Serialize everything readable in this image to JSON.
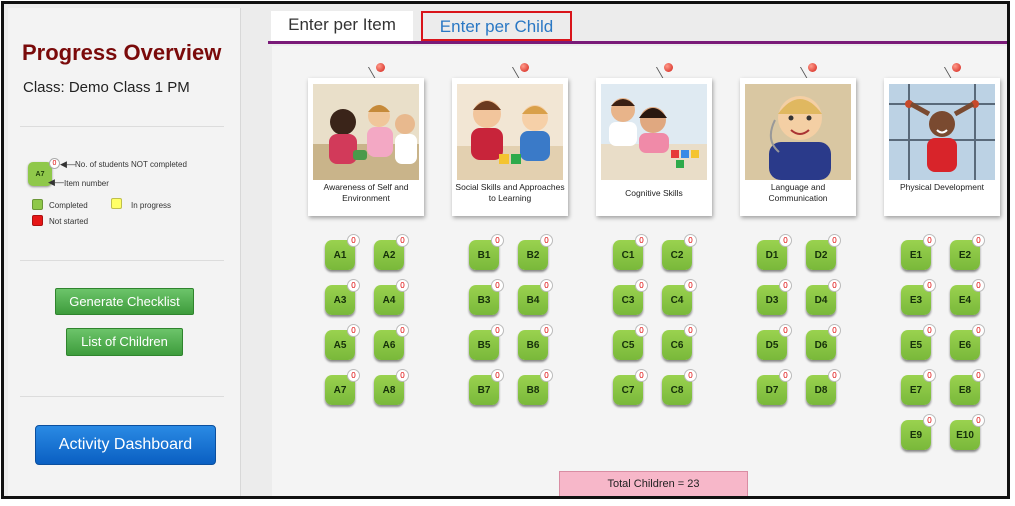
{
  "sidebar": {
    "title": "Progress Overview",
    "class_label": "Class: Demo Class 1 PM",
    "legend": {
      "sample_item": "A7",
      "sample_count": "0",
      "not_completed_label": "No. of students NOT completed",
      "item_number_label": "Item number",
      "completed_label": "Completed",
      "in_progress_label": "In progress",
      "not_started_label": "Not started",
      "colors": {
        "completed": "#8fc84a",
        "in_progress": "#ffff66",
        "not_started": "#e61616"
      }
    },
    "generate_checklist": "Generate Checklist",
    "list_of_children": "List of Children",
    "activity_dashboard": "Activity Dashboard"
  },
  "tabs": [
    {
      "label": "Enter per Item",
      "active": true
    },
    {
      "label": "Enter per Child",
      "active": false
    }
  ],
  "domains": [
    {
      "caption": "Awareness of Self and Environment",
      "items": [
        "A1",
        "A2",
        "A3",
        "A4",
        "A5",
        "A6",
        "A7",
        "A8"
      ]
    },
    {
      "caption": "Social Skills and Approaches to Learning",
      "items": [
        "B1",
        "B2",
        "B3",
        "B4",
        "B5",
        "B6",
        "B7",
        "B8"
      ]
    },
    {
      "caption": "Cognitive Skills",
      "items": [
        "C1",
        "C2",
        "C3",
        "C4",
        "C5",
        "C6",
        "C7",
        "C8"
      ]
    },
    {
      "caption": "Language and Communication",
      "items": [
        "D1",
        "D2",
        "D3",
        "D4",
        "D5",
        "D6",
        "D7",
        "D8"
      ]
    },
    {
      "caption": "Physical Development",
      "items": [
        "E1",
        "E2",
        "E3",
        "E4",
        "E5",
        "E6",
        "E7",
        "E8",
        "E9",
        "E10"
      ]
    }
  ],
  "not_completed_count": "0",
  "total_children": "Total Children = 23",
  "accent": {
    "tab_line": "#7a1a78",
    "title": "#7a0a0a",
    "tile": "#8fc84a"
  }
}
